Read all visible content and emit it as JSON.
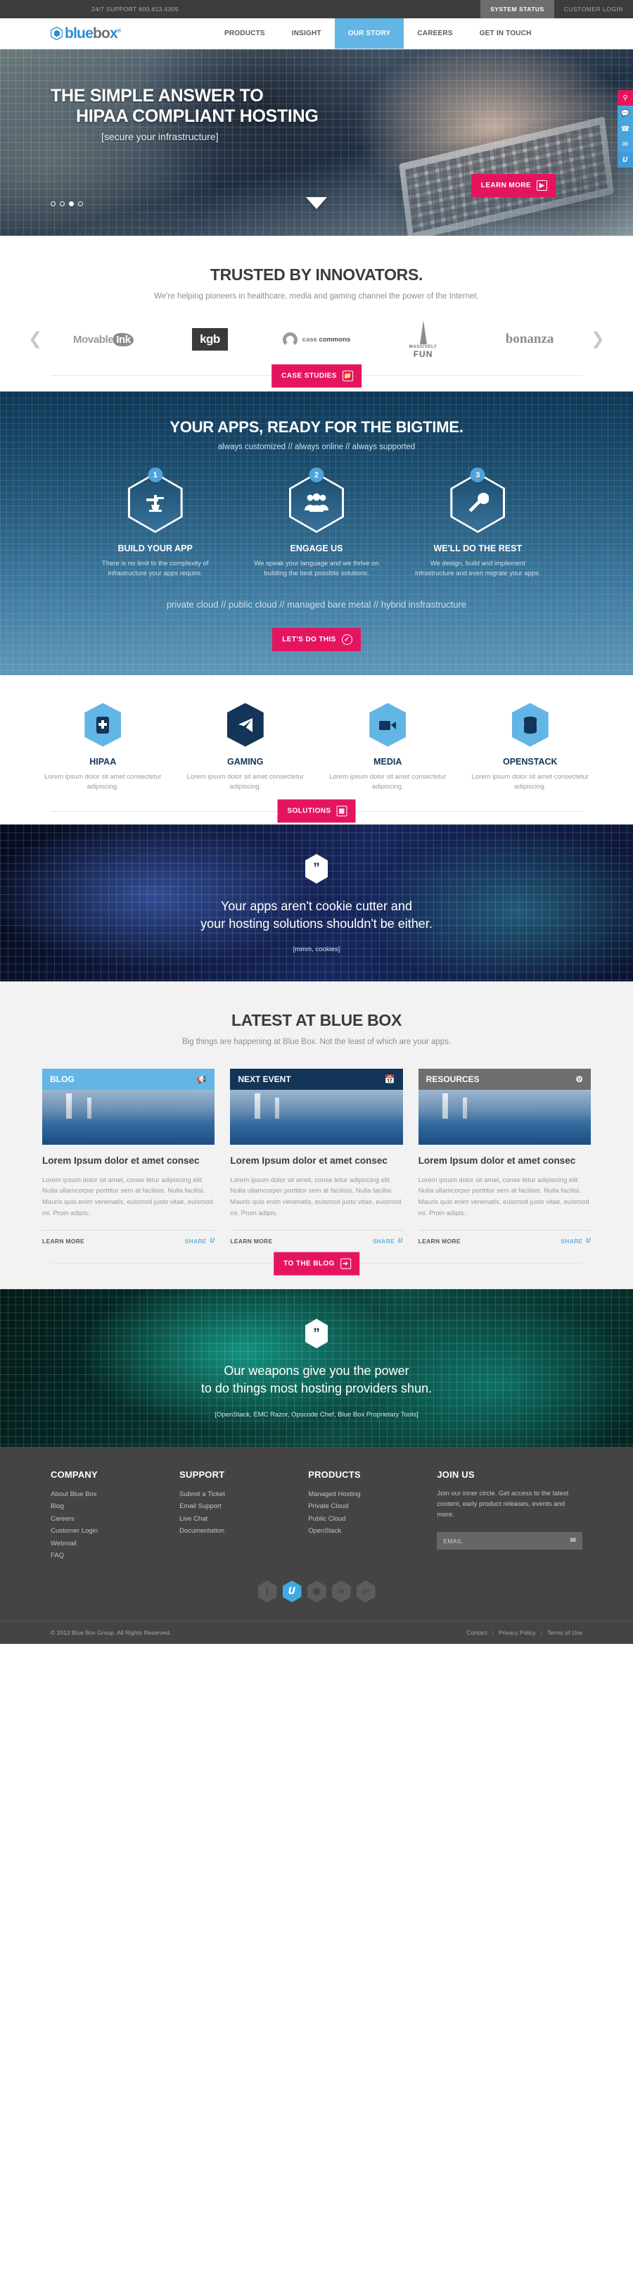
{
  "utilbar": {
    "phone": "24/7 SUPPORT 800.613.4305",
    "system_status": "SYSTEM STATUS",
    "customer_login": "CUSTOMER LOGIN"
  },
  "brand": {
    "name_blue": "blue",
    "name_gray": "bo",
    "name_blue2": "x",
    "trademark": "®"
  },
  "nav": {
    "items": [
      {
        "label": "PRODUCTS",
        "active": false
      },
      {
        "label": "INSIGHT",
        "active": false
      },
      {
        "label": "OUR STORY",
        "active": true
      },
      {
        "label": "CAREERS",
        "active": false
      },
      {
        "label": "GET IN TOUCH",
        "active": false
      }
    ]
  },
  "hero": {
    "title_line1": "THE SIMPLE ANSWER TO",
    "title_line2": "HIPAA COMPLIANT HOSTING",
    "subtitle": "[secure your infrastructure]",
    "cta": "LEARN MORE",
    "cta_icon": "play-icon",
    "dots": [
      false,
      false,
      true,
      false
    ],
    "scroll_icon": "chevron-down-icon"
  },
  "rail": {
    "items": [
      {
        "icon": "search-icon",
        "glyph": "⌕",
        "color": "#e5145f"
      },
      {
        "icon": "chat-icon",
        "glyph": "⬚",
        "color": "#4aa3dc"
      },
      {
        "icon": "phone-icon",
        "glyph": "✆",
        "color": "#4aa3dc"
      },
      {
        "icon": "mail-icon",
        "glyph": "✉",
        "color": "#4aa3dc"
      },
      {
        "icon": "twitter-icon",
        "glyph": "t",
        "color": "#3f9ada"
      }
    ]
  },
  "trusted": {
    "title": "TRUSTED BY INNOVATORS.",
    "subtitle": "We're helping pioneers in healthcare, media and gaming channel the power of the Internet.",
    "prev_icon": "chevron-left-icon",
    "next_icon": "chevron-right-icon",
    "logos": [
      {
        "name": "Movable Ink",
        "part1": "Movable",
        "part2": "Ink"
      },
      {
        "name": "kgb",
        "text": "kgb"
      },
      {
        "name": "case commons",
        "text1": "case ",
        "text2": "commons"
      },
      {
        "name": "Massively Fun",
        "text1": "MASSIVELY",
        "text2": "FUN"
      },
      {
        "name": "bonanza",
        "text": "bonanza"
      }
    ],
    "cta": "CASE STUDIES",
    "cta_icon": "folder-icon"
  },
  "apps": {
    "title": "YOUR APPS, READY FOR THE BIGTIME.",
    "tagline": "always customized // always online // always supported",
    "steps": [
      {
        "number": "1",
        "icon": "anvil-hammer-icon",
        "title": "BUILD YOUR APP",
        "body": "There is no limit to the complexity of infrastructure your apps require."
      },
      {
        "number": "2",
        "icon": "people-group-icon",
        "title": "ENGAGE US",
        "body": "We speak your language and we thrive on building the best possible solutions."
      },
      {
        "number": "3",
        "icon": "wrench-icon",
        "title": "WE'LL DO THE REST",
        "body": "We design, build and implement infrastructure and even migrate your apps."
      }
    ],
    "cloudline": "private cloud // public cloud // managed bare metal // hybrid insfrastructure",
    "cta": "LET'S DO THIS",
    "cta_icon": "check-icon"
  },
  "solutions": {
    "items": [
      {
        "title": "HIPAA",
        "icon": "medical-cross-icon",
        "style": "lt",
        "body": "Lorem ipsum dolor sit amet consectetur adipiscing."
      },
      {
        "title": "GAMING",
        "icon": "paper-plane-icon",
        "style": "dk",
        "body": "Lorem ipsum dolor sit amet consectetur adipiscing."
      },
      {
        "title": "MEDIA",
        "icon": "video-camera-icon",
        "style": "lt",
        "body": "Lorem ipsum dolor sit amet consectetur adipiscing."
      },
      {
        "title": "OPENSTACK",
        "icon": "database-stack-icon",
        "style": "lt",
        "body": "Lorem ipsum dolor sit amet consectetur adipiscing."
      }
    ],
    "cta": "SOLUTIONS",
    "cta_icon": "grid-icon"
  },
  "quote1": {
    "icon": "quote-mark-icon",
    "line1": "Your apps aren't cookie cutter and",
    "line2": "your hosting solutions shouldn't be either.",
    "caption": "[mmm, cookies]"
  },
  "quote2": {
    "icon": "quote-mark-icon",
    "line1": "Our weapons give you the power",
    "line2": "to do things most hosting providers shun.",
    "caption": "[OpenStack, EMC Razor, Opscode Chef, Blue Box Proprietary Tools]"
  },
  "latest": {
    "title": "LATEST AT BLUE BOX",
    "subtitle": "Big things are happening at Blue Box. Not the least of which are your apps.",
    "cards": [
      {
        "label": "BLOG",
        "icon": "megaphone-icon",
        "style": "blue",
        "heading": "Lorem Ipsum dolor et amet consec",
        "body": "Lorem ipsum dolor sit amet, conse tetur adipiscing elit. Nulla ullamcorper porttitor sem at facilisis. Nulla facilisi. Mauris quis enim venenatis, euismod justo vitae, euismod mi. Proin adipis.",
        "learn_more": "LEARN MORE",
        "share": "SHARE",
        "share_icon": "twitter-icon"
      },
      {
        "label": "NEXT EVENT",
        "icon": "calendar-icon",
        "style": "navy",
        "heading": "Lorem Ipsum dolor et amet consec",
        "body": "Lorem ipsum dolor sit amet, conse tetur adipiscing elit. Nulla ullamcorper porttitor sem at facilisis. Nulla facilisi. Mauris quis enim venenatis, euismod justo vitae, euismod mi. Proin adipis.",
        "learn_more": "LEARN MORE",
        "share": "SHARE",
        "share_icon": "twitter-icon"
      },
      {
        "label": "RESOURCES",
        "icon": "gear-icon",
        "style": "gray",
        "heading": "Lorem Ipsum dolor et amet consec",
        "body": "Lorem ipsum dolor sit amet, conse tetur adipiscing elit. Nulla ullamcorper porttitor sem at facilisis. Nulla facilisi. Mauris quis enim venenatis, euismod justo vitae, euismod mi. Proin adipis.",
        "learn_more": "LEARN MORE",
        "share": "SHARE",
        "share_icon": "twitter-icon"
      }
    ],
    "cta": "TO THE BLOG",
    "cta_icon": "arrow-right-icon"
  },
  "footer": {
    "columns": [
      {
        "title": "COMPANY",
        "links": [
          "About Blue Box",
          "Blog",
          "Careers",
          "Customer Login",
          "Webmail",
          "FAQ"
        ]
      },
      {
        "title": "SUPPORT",
        "links": [
          "Submit a Ticket",
          "Email Support",
          "Live Chat",
          "Documentation"
        ]
      },
      {
        "title": "PRODUCTS",
        "links": [
          "Managed Hosting",
          "Private Cloud",
          "Public Cloud",
          "OpenStack"
        ]
      }
    ],
    "join": {
      "title": "JOIN US",
      "text": "Join our inner circle. Get access to the latest content, early product releases, events and more.",
      "email_placeholder": "EMAIL",
      "email_value": "",
      "submit_icon": "envelope-icon"
    },
    "socials": [
      {
        "name": "facebook-icon",
        "glyph": "f",
        "active": false
      },
      {
        "name": "twitter-icon",
        "glyph": "t",
        "active": true
      },
      {
        "name": "github-icon",
        "glyph": "◑",
        "active": false
      },
      {
        "name": "linkedin-icon",
        "glyph": "in",
        "active": false
      },
      {
        "name": "googleplus-icon",
        "glyph": "g+",
        "active": false
      }
    ],
    "copyright": "© 2013 Blue Box Group. All Rights Reserved.",
    "links": [
      "Contact",
      "Privacy Policy",
      "Terms of Use"
    ],
    "link_sep": "|"
  }
}
